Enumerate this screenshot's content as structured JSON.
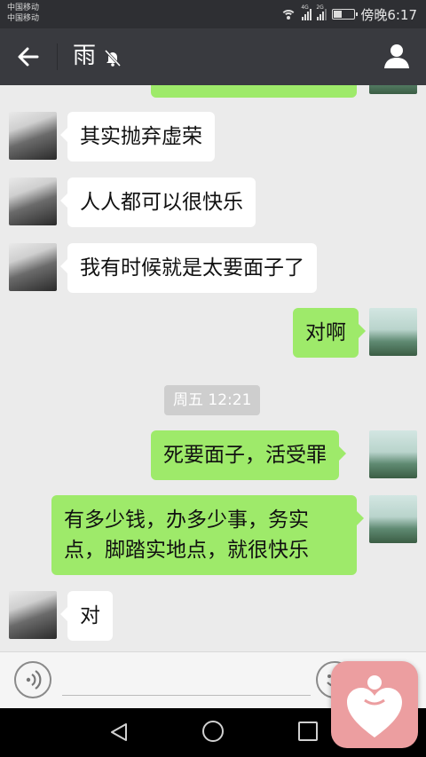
{
  "status_bar": {
    "carrier_1": "中国移动",
    "carrier_2": "中国移动",
    "network_1": "4G",
    "network_2": "2G",
    "time": "傍晚6:17",
    "battery_level": 0.35
  },
  "header": {
    "title": "雨",
    "back_icon": "arrow-left-icon",
    "mute_icon": "bell-off-icon",
    "profile_icon": "person-icon"
  },
  "messages": [
    {
      "side": "right",
      "text": ""
    },
    {
      "side": "left",
      "text": "其实抛弃虚荣"
    },
    {
      "side": "left",
      "text": "人人都可以很快乐"
    },
    {
      "side": "left",
      "text": "我有时候就是太要面子了"
    },
    {
      "side": "right",
      "text": "对啊"
    },
    {
      "side": "right",
      "text": "死要面子，活受罪"
    },
    {
      "side": "right",
      "text": "有多少钱，办多少事，务实点，脚踏实地点，就很快乐",
      "line1": "有多少钱，办多少事，务实",
      "line2": "点，脚踏实地点，就很快乐"
    },
    {
      "side": "left",
      "text": "对"
    }
  ],
  "timestamp": "周五 12:21",
  "colors": {
    "status_bar_bg": "#2e2f33",
    "header_bg": "#393a3f",
    "chat_bg": "#ebebeb",
    "bubble_sent": "#9eea6a",
    "bubble_received": "#ffffff",
    "floating_app": "#ec9ea0"
  },
  "input_bar": {
    "voice_icon": "voice-icon",
    "emoji_icon": "emoji-icon",
    "plus_icon": "plus-icon"
  },
  "nav_bar": {
    "back_icon": "triangle-back-icon",
    "home_icon": "circle-home-icon",
    "recent_icon": "square-recent-icon"
  },
  "floating_app": {
    "icon": "heart-person-icon"
  }
}
